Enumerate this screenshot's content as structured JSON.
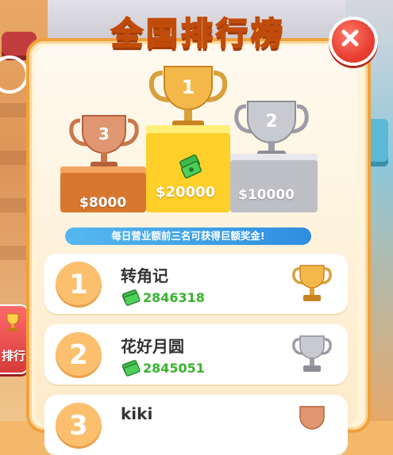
{
  "title": "全国排行榜",
  "side_button": {
    "label": "排行"
  },
  "podium": {
    "first": {
      "rank": "1",
      "prize": "$20000"
    },
    "second": {
      "rank": "2",
      "prize": "$10000"
    },
    "third": {
      "rank": "3",
      "prize": "$8000"
    }
  },
  "banner": "每日营业额前三名可获得巨额奖金!",
  "rows": [
    {
      "rank": "1",
      "name": "转角记",
      "score": "2846318",
      "trophy": "gold-trophy-icon"
    },
    {
      "rank": "2",
      "name": "花好月圆",
      "score": "2845051",
      "trophy": "silver-trophy-icon"
    },
    {
      "rank": "3",
      "name": "kiki",
      "score": "",
      "trophy": "bronze-trophy-icon"
    }
  ],
  "colors": {
    "gold": "#ffcf2a",
    "silver": "#bfbfc6",
    "bronze": "#d8782f",
    "score_green": "#39b32e",
    "close_red": "#e63b2e"
  }
}
